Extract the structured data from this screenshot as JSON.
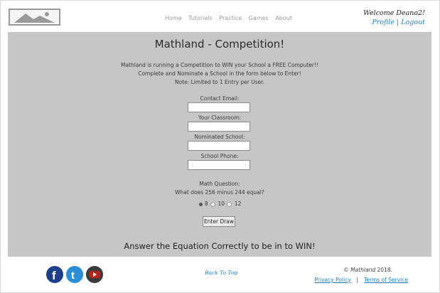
{
  "header": {
    "logo_icon": "image-placeholder-icon",
    "nav": [
      "Home",
      "Tutorials",
      "Practice",
      "Games",
      "About"
    ],
    "welcome": "Welcome Deano2!",
    "profile_link": "Profile",
    "link_separator": "|",
    "logout_link": "Logout"
  },
  "main": {
    "title": "Mathland - Competition!",
    "intro_lines": [
      "Mathland is running a Competition to WIN your School a FREE Computer!!",
      "Complete and Nominate a School in the form below to Enter!",
      "Note: Limited to 1 Entry per User."
    ],
    "fields": [
      {
        "label": "Contact Email:",
        "value": ""
      },
      {
        "label": "Your Classroom:",
        "value": ""
      },
      {
        "label": "Nominated School:",
        "value": ""
      },
      {
        "label": "School Phone:",
        "value": ""
      }
    ],
    "question_label": "Math Question:",
    "question": "What does 256 minus 244 equal?",
    "options": [
      "8",
      "10",
      "12"
    ],
    "selected_option": "8",
    "submit_label": "Enter Draw",
    "tagline": "Answer the Equation Correctly to be in to WIN!"
  },
  "footer": {
    "social_icons": [
      "facebook-icon",
      "twitter-icon",
      "youtube-icon"
    ],
    "back_to_top": "Back To Top",
    "copyright_symbol": "©",
    "copyright_brand": "Mathland",
    "copyright_year": "2018.",
    "privacy": "Privacy Policy",
    "legal_separator": "|",
    "terms": "Terms of Service"
  },
  "colors": {
    "link": "#1b7fc8",
    "main_bg": "#c6c6c6",
    "facebook": "#1d3f8a",
    "twitter": "#2a8fd6",
    "youtube": "#b3261e"
  }
}
